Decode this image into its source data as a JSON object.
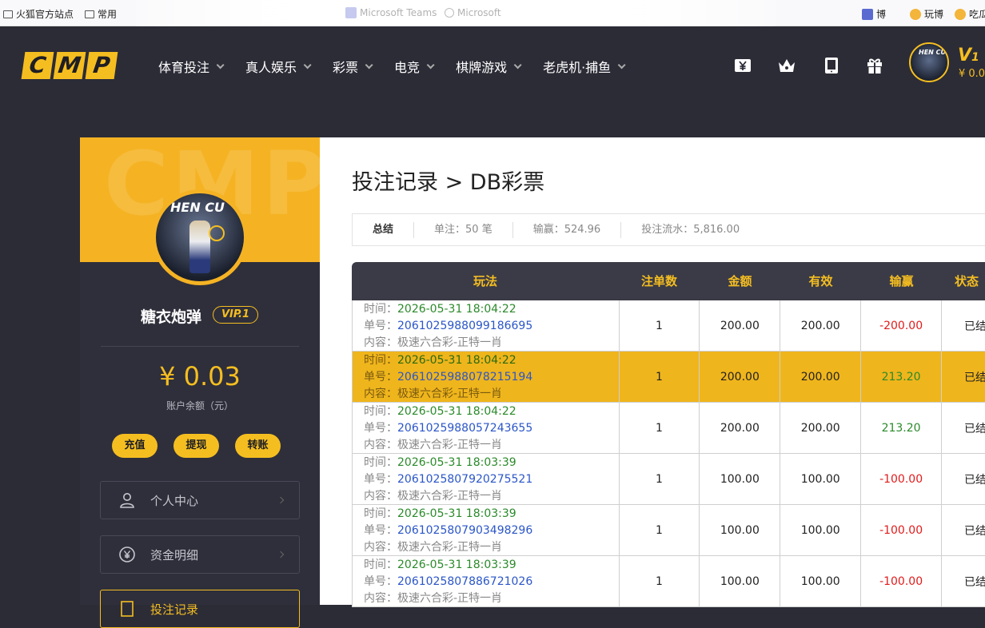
{
  "bookmarks": [
    {
      "label": "火狐官方站点",
      "icon": "folder-icon"
    },
    {
      "label": "常用",
      "icon": "folder-icon"
    },
    {
      "label": "Microsoft Teams",
      "icon": "teams-icon"
    },
    {
      "label": "Microsoft",
      "icon": "globe-icon"
    },
    {
      "label": "博",
      "icon": "app-icon"
    },
    {
      "label": "玩博",
      "icon": "trophy-icon"
    },
    {
      "label": "吃瓜",
      "icon": "trophy-icon"
    }
  ],
  "logo": {
    "letters": [
      "C",
      "M",
      "P"
    ]
  },
  "nav": [
    {
      "label": "体育投注"
    },
    {
      "label": "真人娱乐"
    },
    {
      "label": "彩票"
    },
    {
      "label": "电竞"
    },
    {
      "label": "棋牌游戏"
    },
    {
      "label": "老虎机·捕鱼"
    }
  ],
  "header_icons": [
    "yen-card-icon",
    "crown-icon",
    "tablet-icon",
    "gift-icon"
  ],
  "user": {
    "name": "糖衣炮弹",
    "vip_badge": "VIP.1",
    "vip_top": "V",
    "vip_top_level": "1",
    "balance_top": "¥ 0.0",
    "avatar_text": "HEN CU",
    "balance": "¥ 0.03",
    "balance_label": "账户余额（元）"
  },
  "sidebar": {
    "watermark": "CMP",
    "actions": [
      {
        "label": "充值"
      },
      {
        "label": "提现"
      },
      {
        "label": "转账"
      }
    ],
    "menu": [
      {
        "label": "个人中心",
        "icon": "user-icon"
      },
      {
        "label": "资金明细",
        "icon": "yen-circle-icon"
      },
      {
        "label": "投注记录",
        "icon": "document-icon"
      }
    ]
  },
  "page": {
    "title": "投注记录 > DB彩票",
    "summary": {
      "label": "总结",
      "count": "单注：50 笔",
      "winloss": "输赢：524.96",
      "turnover": "投注流水：5,816.00"
    }
  },
  "table": {
    "headers": [
      "玩法",
      "注单数",
      "金额",
      "有效",
      "输赢",
      "状态"
    ],
    "labels": {
      "time": "时间：",
      "order": "单号：",
      "content": "内容："
    },
    "rows": [
      {
        "time": "2026-05-31 18:04:22",
        "order": "2061025988099186695",
        "content": "极速六合彩-正特一肖",
        "count": "1",
        "amount": "200.00",
        "valid": "200.00",
        "winloss": "-200.00",
        "result": "neg",
        "status": "已结",
        "highlight": false
      },
      {
        "time": "2026-05-31 18:04:22",
        "order": "2061025988078215194",
        "content": "极速六合彩-正特一肖",
        "count": "1",
        "amount": "200.00",
        "valid": "200.00",
        "winloss": "213.20",
        "result": "pos",
        "status": "已结",
        "highlight": true
      },
      {
        "time": "2026-05-31 18:04:22",
        "order": "2061025988057243655",
        "content": "极速六合彩-正特一肖",
        "count": "1",
        "amount": "200.00",
        "valid": "200.00",
        "winloss": "213.20",
        "result": "pos",
        "status": "已结",
        "highlight": false
      },
      {
        "time": "2026-05-31 18:03:39",
        "order": "2061025807920275521",
        "content": "极速六合彩-正特一肖",
        "count": "1",
        "amount": "100.00",
        "valid": "100.00",
        "winloss": "-100.00",
        "result": "neg",
        "status": "已结",
        "highlight": false
      },
      {
        "time": "2026-05-31 18:03:39",
        "order": "2061025807903498296",
        "content": "极速六合彩-正特一肖",
        "count": "1",
        "amount": "100.00",
        "valid": "100.00",
        "winloss": "-100.00",
        "result": "neg",
        "status": "已结",
        "highlight": false
      },
      {
        "time": "2026-05-31 18:03:39",
        "order": "2061025807886721026",
        "content": "极速六合彩-正特一肖",
        "count": "1",
        "amount": "100.00",
        "valid": "100.00",
        "winloss": "-100.00",
        "result": "neg",
        "status": "已结",
        "highlight": false
      }
    ]
  },
  "colors": {
    "accent": "#f5be20",
    "header_bg": "#2c2c37",
    "negative": "#e01b1b",
    "positive": "#2a8a2a",
    "order_link": "#2b56c8"
  }
}
